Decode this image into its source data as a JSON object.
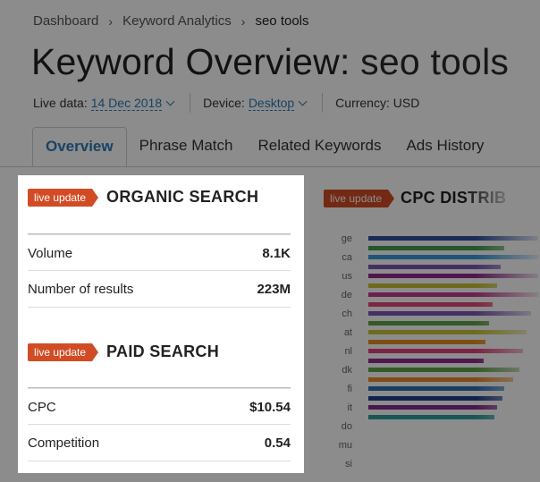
{
  "breadcrumb": {
    "items": [
      "Dashboard",
      "Keyword Analytics",
      "seo tools"
    ]
  },
  "title": {
    "prefix": "Keyword Overview:",
    "keyword": "seo tools"
  },
  "meta": {
    "live_data_label": "Live data:",
    "live_data_value": "14 Dec 2018",
    "device_label": "Device:",
    "device_value": "Desktop",
    "currency_label": "Currency: USD"
  },
  "tabs": [
    {
      "label": "Overview",
      "active": true
    },
    {
      "label": "Phrase Match",
      "active": false
    },
    {
      "label": "Related Keywords",
      "active": false
    },
    {
      "label": "Ads History",
      "active": false
    }
  ],
  "badge_text": "live update",
  "organic": {
    "title": "ORGANIC SEARCH",
    "rows": [
      {
        "label": "Volume",
        "value": "8.1K"
      },
      {
        "label": "Number of results",
        "value": "223M"
      }
    ]
  },
  "paid": {
    "title": "PAID SEARCH",
    "rows": [
      {
        "label": "CPC",
        "value": "$10.54"
      },
      {
        "label": "Competition",
        "value": "0.54"
      }
    ]
  },
  "cpc_chart": {
    "title": "CPC DISTRIB",
    "bars": [
      {
        "country": "ge",
        "value": 1.0,
        "color": "#2e4f9e"
      },
      {
        "country": "ca",
        "value": 1.0,
        "color": "#3a9ad9"
      },
      {
        "country": "us",
        "value": 1.0,
        "color": "#8e2b8e"
      },
      {
        "country": "de",
        "value": 1.0,
        "color": "#c23d8a"
      },
      {
        "country": "ch",
        "value": 0.96,
        "color": "#7c58b8"
      },
      {
        "country": "at",
        "value": 0.93,
        "color": "#c8c437"
      },
      {
        "country": "nl",
        "value": 0.91,
        "color": "#e0407c"
      },
      {
        "country": "dk",
        "value": 0.89,
        "color": "#62a345"
      },
      {
        "country": "fi",
        "value": 0.85,
        "color": "#e88b26"
      },
      {
        "country": "it",
        "value": 0.8,
        "color": "#2b6fb3"
      },
      {
        "country": "do",
        "value": 0.79,
        "color": "#1f3f8a"
      },
      {
        "country": "mu",
        "value": 0.76,
        "color": "#852b8a"
      },
      {
        "country": "si",
        "value": 0.74,
        "color": "#2f9e9a"
      }
    ],
    "extra_bars": [
      {
        "value": 0.8,
        "color": "#3e9e48"
      },
      {
        "value": 0.78,
        "color": "#7a56b5"
      },
      {
        "value": 0.76,
        "color": "#c6c236"
      },
      {
        "value": 0.73,
        "color": "#e3457b"
      },
      {
        "value": 0.71,
        "color": "#62a345"
      },
      {
        "value": 0.69,
        "color": "#e88b26"
      },
      {
        "value": 0.68,
        "color": "#8e2b8e"
      }
    ]
  }
}
